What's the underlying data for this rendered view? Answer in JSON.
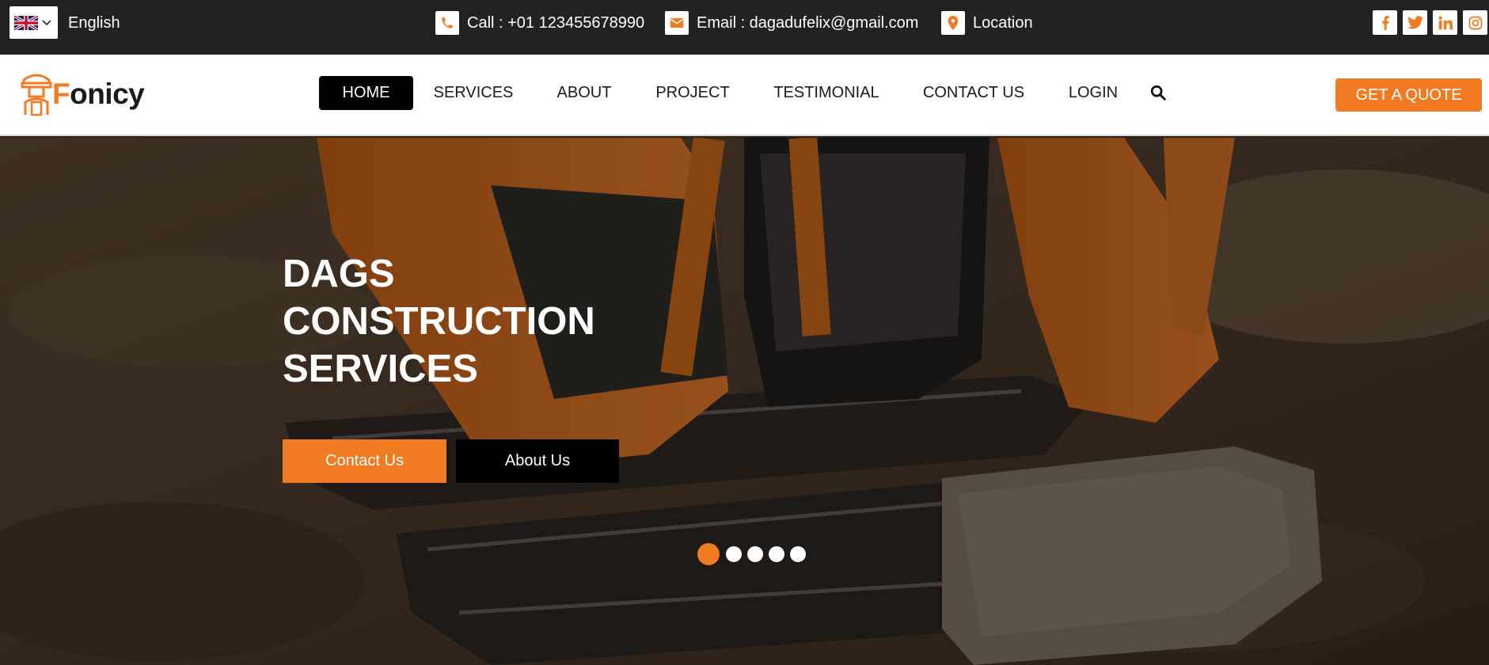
{
  "topbar": {
    "language": "English",
    "phone": "Call : +01 123455678990",
    "email": "Email : dagadufelix@gmail.com",
    "location": "Location",
    "social": [
      {
        "icon": "facebook-icon",
        "glyph": "f"
      },
      {
        "icon": "twitter-icon",
        "glyph": "t"
      },
      {
        "icon": "linkedin-icon",
        "glyph": "in"
      },
      {
        "icon": "instagram-icon",
        "glyph": "ig"
      }
    ]
  },
  "brand": {
    "name_first": "F",
    "name_rest": "onicy"
  },
  "nav": {
    "items": [
      "HOME",
      "SERVICES",
      "ABOUT",
      "PROJECT",
      "TESTIMONIAL",
      "CONTACT US",
      "LOGIN"
    ],
    "active": "HOME",
    "cta": "GET A QUOTE"
  },
  "hero": {
    "title_lines": [
      "DAGS",
      "CONSTRUCTION",
      "SERVICES"
    ],
    "primary_button": "Contact Us",
    "secondary_button": "About Us",
    "slide_count": 5,
    "active_slide": 1
  },
  "colors": {
    "accent": "#f07b22",
    "topbar_bg": "#222222",
    "dark_button": "#000000"
  }
}
